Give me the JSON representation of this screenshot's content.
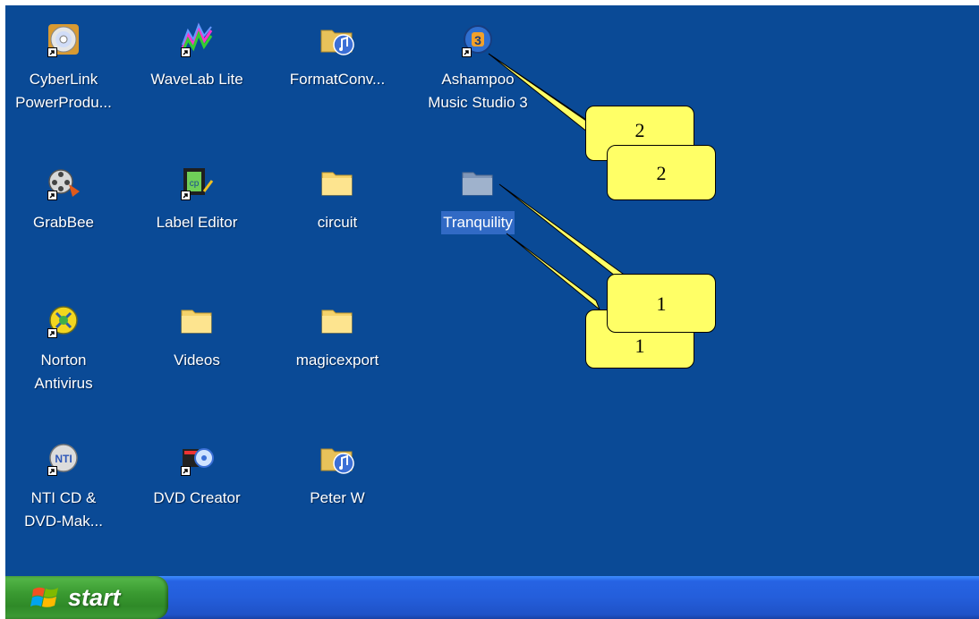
{
  "desktop": {
    "icons": [
      {
        "lines": [
          "CyberLink",
          "PowerProdu..."
        ],
        "icon": "cd-disc-icon",
        "shortcut": true
      },
      {
        "lines": [
          "WaveLab Lite"
        ],
        "icon": "waveform-icon",
        "shortcut": true
      },
      {
        "lines": [
          "FormatConv..."
        ],
        "icon": "music-folder-icon",
        "shortcut": false
      },
      {
        "lines": [
          "Ashampoo",
          "Music Studio 3"
        ],
        "icon": "music-studio-icon",
        "shortcut": true
      },
      {
        "lines": [
          "GrabBee"
        ],
        "icon": "film-reel-icon",
        "shortcut": true
      },
      {
        "lines": [
          "Label Editor"
        ],
        "icon": "label-editor-icon",
        "shortcut": true
      },
      {
        "lines": [
          "circuit"
        ],
        "icon": "folder-icon",
        "shortcut": false
      },
      {
        "lines": [
          "Tranquility"
        ],
        "icon": "folder-icon",
        "shortcut": false,
        "selected": true
      },
      {
        "lines": [
          "Norton",
          "Antivirus"
        ],
        "icon": "norton-icon",
        "shortcut": true
      },
      {
        "lines": [
          "Videos"
        ],
        "icon": "folder-icon",
        "shortcut": false
      },
      {
        "lines": [
          "magicexport"
        ],
        "icon": "folder-icon",
        "shortcut": false
      },
      {
        "lines": [
          "NTI CD &",
          "DVD-Mak..."
        ],
        "icon": "nti-disc-icon",
        "shortcut": true
      },
      {
        "lines": [
          "DVD Creator"
        ],
        "icon": "dvd-creator-icon",
        "shortcut": true
      },
      {
        "lines": [
          "Peter W"
        ],
        "icon": "music-folder-icon",
        "shortcut": false
      }
    ]
  },
  "callouts": [
    {
      "label": "2",
      "target_icon": "Ashampoo Music Studio 3"
    },
    {
      "label": "2",
      "target_icon": "Ashampoo Music Studio 3"
    },
    {
      "label": "1",
      "target_icon": "Tranquility"
    },
    {
      "label": "1",
      "target_icon": "Tranquility"
    }
  ],
  "taskbar": {
    "start_label": "start"
  },
  "colors": {
    "desktop_bg": "#0a4a96",
    "selection": "#316ac5",
    "callout_fill": "#ffff66",
    "start_green": "#3a9a31",
    "taskbar_blue": "#245edb"
  }
}
